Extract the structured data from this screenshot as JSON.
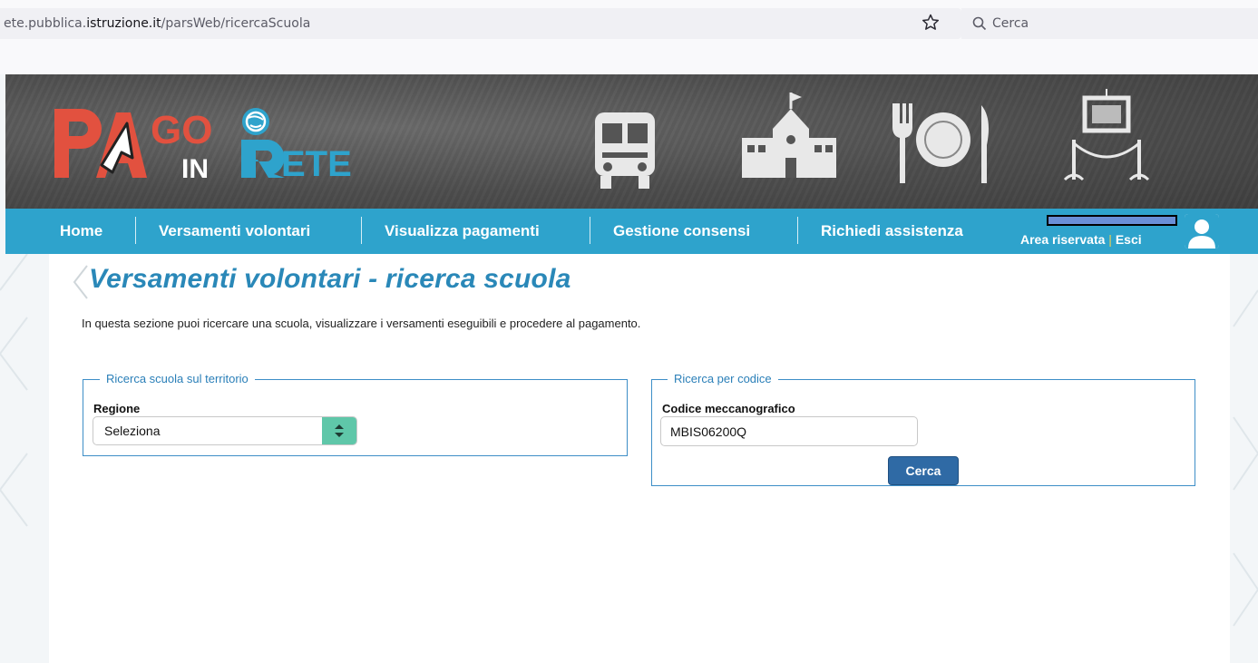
{
  "browser": {
    "url_prefix": "ete.pubblica.",
    "url_host": "istruzione.it",
    "url_path": "/parsWeb/ricercaScuola",
    "search_placeholder": "Cerca"
  },
  "header": {
    "logo_text": "PAGO IN RETE",
    "logo_in": "IN",
    "logo_rete": "ETE"
  },
  "nav": {
    "items": [
      {
        "label": "Home"
      },
      {
        "label": "Versamenti volontari"
      },
      {
        "label": "Visualizza pagamenti"
      },
      {
        "label": "Gestione consensi"
      },
      {
        "label": "Richiedi assistenza"
      }
    ],
    "area_riservata": "Area riservata",
    "separator": "|",
    "esci": "Esci"
  },
  "page": {
    "title": "Versamenti volontari - ricerca scuola",
    "intro": "In questa sezione puoi ricercare una scuola, visualizzare i versamenti eseguibili e procedere al pagamento."
  },
  "territory_search": {
    "legend": "Ricerca scuola sul territorio",
    "region_label": "Regione",
    "region_value": "Seleziona"
  },
  "code_search": {
    "legend": "Ricerca per codice",
    "code_label": "Codice meccanografico",
    "code_value": "MBIS06200Q",
    "search_button": "Cerca"
  },
  "colors": {
    "nav_bg": "#2ea3cc",
    "title": "#2a88b8",
    "button": "#2f6aa5",
    "select_arrow": "#5fc7a9"
  }
}
